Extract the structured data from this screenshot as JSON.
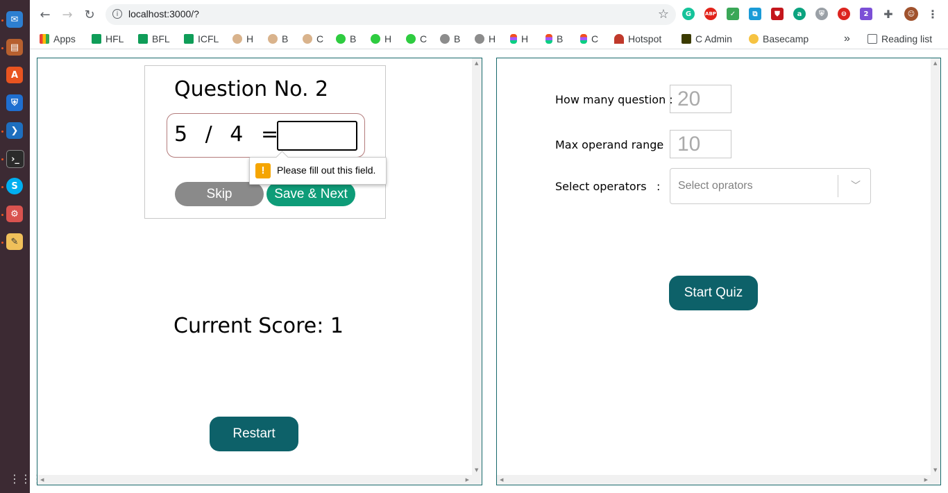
{
  "browser": {
    "url": "localhost:3000/?",
    "bookmarks": [
      "Apps",
      "HFL",
      "BFL",
      "ICFL",
      "H",
      "B",
      "C",
      "B",
      "H",
      "C",
      "B",
      "H",
      "H",
      "B",
      "C",
      "Hotspot",
      "C Admin",
      "Basecamp"
    ],
    "overflow_label": "»",
    "reading_list": "Reading list"
  },
  "quiz": {
    "question_title": "Question No. 2",
    "operand1": "5",
    "operator": "/",
    "operand2": "4",
    "equals": "=",
    "answer_value": "",
    "validation_message": "Please fill out this field.",
    "skip_label": "Skip",
    "save_next_label": "Save & Next",
    "score_text": "Current Score: 1",
    "restart_label": "Restart"
  },
  "setup": {
    "question_count_label": "How many question :",
    "question_count_placeholder": "20",
    "max_range_label": "Max operand range",
    "max_range_colon": ":",
    "max_range_placeholder": "10",
    "operators_label": "Select operators",
    "operators_colon": ":",
    "operators_placeholder": "Select oprators",
    "start_label": "Start Quiz"
  },
  "colors": {
    "pane_border": "#17696b",
    "primary_button": "#0d6169",
    "save_button": "#0e9c78",
    "skip_button": "#8a8a8a"
  }
}
